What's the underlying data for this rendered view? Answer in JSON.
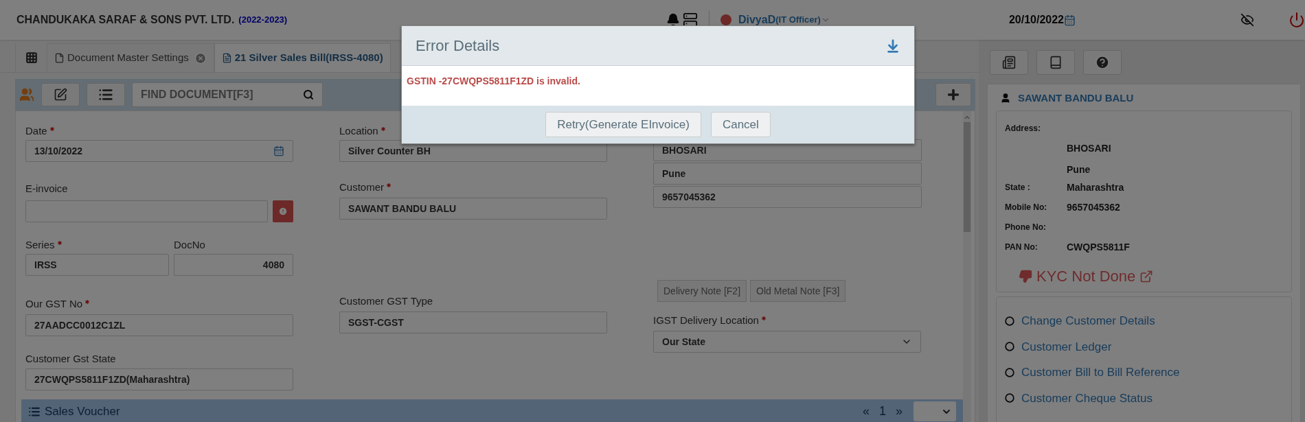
{
  "header": {
    "company": "CHANDUKAKA SARAF & SONS PVT. LTD.",
    "year": "(2022-2023)",
    "user": {
      "name": "DivyaD",
      "role": "(IT Officer)",
      "online": false
    },
    "date": "20/10/2022"
  },
  "tabs": [
    {
      "label": "Document Master Settings",
      "selected": false,
      "closable": true
    },
    {
      "label": "21 Silver Sales Bill(IRSS-4080)",
      "selected": true,
      "closable": false
    }
  ],
  "toolbar": {
    "search": {
      "placeholder": "FIND DOCUMENT[F3]"
    }
  },
  "form": {
    "date": {
      "label": "Date",
      "required": true,
      "value": "13/10/2022"
    },
    "einvoice": {
      "label": "E-invoice",
      "required": false
    },
    "series": {
      "label": "Series",
      "required": true,
      "value": "IRSS"
    },
    "docno": {
      "label": "DocNo",
      "required": false,
      "value": "4080"
    },
    "our_gst": {
      "label": "Our GST No",
      "required": true,
      "value": "27AADCC0012C1ZL"
    },
    "customer_gst_state": {
      "label": "Customer Gst State",
      "required": false,
      "value": "27CWQPS5811F1ZD(Maharashtra)"
    },
    "location": {
      "label": "Location",
      "required": true,
      "value": "Silver Counter BH"
    },
    "customer": {
      "label": "Customer",
      "required": true,
      "value": "SAWANT BANDU BALU"
    },
    "customer_gst_type": {
      "label": "Customer GST Type",
      "required": false,
      "value": "SGST-CGST"
    },
    "address_lines": [
      "BHOSARI",
      "Pune",
      "9657045362"
    ],
    "note_buttons": [
      "Delivery Note [F2]",
      "Old Metal Note [F3]"
    ],
    "igst_delivery_location": {
      "label": "IGST Delivery Location",
      "required": true,
      "value": "Our State"
    }
  },
  "sales_voucher": {
    "title": "Sales Voucher",
    "prev": "«",
    "page": "1",
    "next": "»"
  },
  "customer_panel": {
    "name": "SAWANT BANDU BALU",
    "address_label": "Address:",
    "address_lines": [
      "BHOSARI",
      "Pune"
    ],
    "details": [
      {
        "label": "State :",
        "value": "Maharashtra"
      },
      {
        "label": "Mobile No:",
        "value": "9657045362"
      },
      {
        "label": "Phone No:"
      },
      {
        "label": "PAN No:",
        "value": "CWQPS5811F"
      }
    ],
    "kyc": "KYC Not Done",
    "links": [
      "Change Customer Details",
      "Customer Ledger",
      "Customer Bill to Bill Reference",
      "Customer Cheque Status"
    ]
  },
  "modal": {
    "title": "Error Details",
    "message": "GSTIN -27CWQPS5811F1ZD is invalid.",
    "buttons": [
      "Retry(Generate EInvoice)",
      "Cancel"
    ]
  }
}
